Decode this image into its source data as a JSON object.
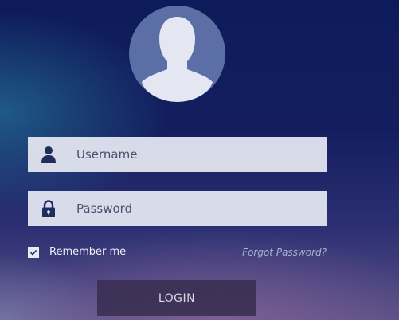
{
  "avatar": {
    "icon": "user-silhouette-icon"
  },
  "form": {
    "username": {
      "icon": "user-icon",
      "placeholder": "Username",
      "value": ""
    },
    "password": {
      "icon": "lock-icon",
      "placeholder": "Password",
      "value": ""
    },
    "remember": {
      "label": "Remember me",
      "checked": true
    },
    "forgot_label": "Forgot Password?",
    "login_label": "LOGIN"
  },
  "colors": {
    "field_background": "#e6e8f2",
    "icon_color": "#1d2d5e",
    "button_background": "#372d50",
    "link_color": "#a9b1d1"
  }
}
